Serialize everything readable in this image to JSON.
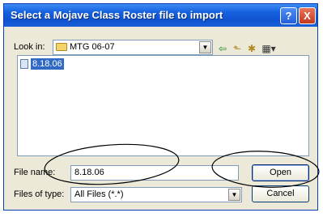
{
  "dialog": {
    "title": "Select a Mojave Class Roster file to import",
    "help_symbol": "?",
    "close_symbol": "X"
  },
  "look_in": {
    "label": "Look in:",
    "value": "MTG 06-07",
    "icon": "folder-icon"
  },
  "toolbar": {
    "back_icon": "⇦",
    "up_icon": "⬑",
    "new_folder_icon": "✱",
    "view_icon": "▦▾"
  },
  "file_list": {
    "items": [
      {
        "name": "8.18.06",
        "icon": "document-icon",
        "selected": true
      }
    ]
  },
  "file_name": {
    "label": "File name:",
    "value": "8.18.06"
  },
  "files_of_type": {
    "label": "Files of type:",
    "value": "All Files (*.*)"
  },
  "buttons": {
    "open": "Open",
    "cancel": "Cancel"
  },
  "colors": {
    "titlebar": "#0f52d0",
    "dialog_bg": "#ece9d8",
    "selection": "#316ac5",
    "annotation": "#000000"
  }
}
